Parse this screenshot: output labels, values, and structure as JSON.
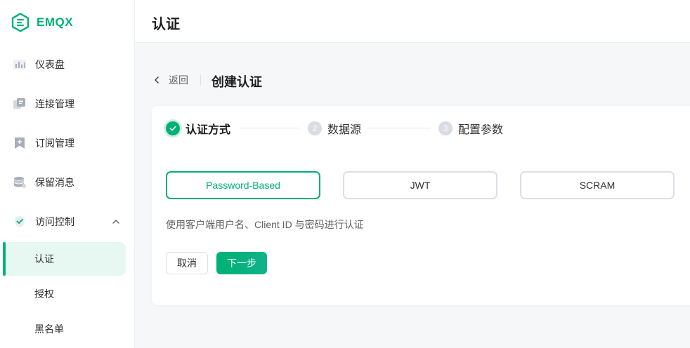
{
  "app": {
    "logo_text": "EMQX",
    "brand_color": "#00b173"
  },
  "sidebar": {
    "items": [
      {
        "label": "仪表盘",
        "icon": "dashboard-icon"
      },
      {
        "label": "连接管理",
        "icon": "connections-icon"
      },
      {
        "label": "订阅管理",
        "icon": "subscription-icon"
      },
      {
        "label": "保留消息",
        "icon": "database-icon"
      },
      {
        "label": "访问控制",
        "icon": "shield-check-icon",
        "expanded": true
      }
    ],
    "sub_items": [
      {
        "label": "认证",
        "active": true
      },
      {
        "label": "授权",
        "active": false
      },
      {
        "label": "黑名单",
        "active": false
      }
    ]
  },
  "header": {
    "title": "认证"
  },
  "breadcrumb": {
    "back_label": "返回",
    "title": "创建认证"
  },
  "steps": [
    {
      "number": "1",
      "label": "认证方式",
      "state": "done"
    },
    {
      "number": "2",
      "label": "数据源",
      "state": "todo"
    },
    {
      "number": "3",
      "label": "配置参数",
      "state": "todo"
    }
  ],
  "options": [
    {
      "label": "Password-Based",
      "selected": true
    },
    {
      "label": "JWT",
      "selected": false
    },
    {
      "label": "SCRAM",
      "selected": false
    }
  ],
  "description": "使用客户端用户名、Client ID 与密码进行认证",
  "buttons": {
    "cancel": "取消",
    "next": "下一步"
  }
}
